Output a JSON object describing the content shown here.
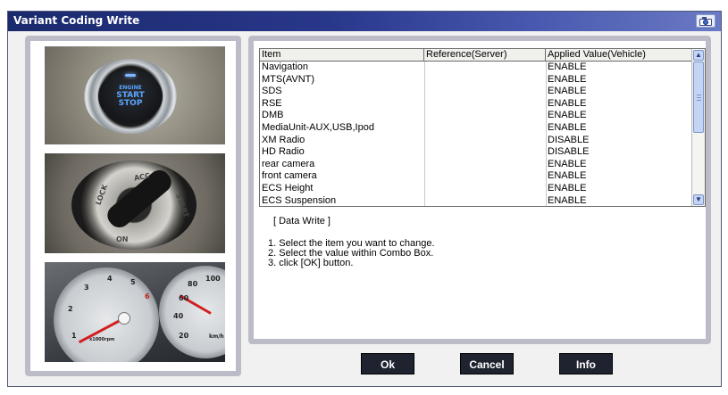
{
  "window": {
    "title": "Variant Coding Write",
    "camera_icon": "camera-icon"
  },
  "left_images": {
    "start_button": {
      "line1": "ENGINE",
      "line2": "START",
      "line3": "STOP"
    },
    "ignition_lock": {
      "lbl_lock": "LOCK",
      "lbl_acc": "ACC",
      "lbl_start": "START",
      "lbl_ign": "ON"
    },
    "gauges": {
      "tach": [
        "1",
        "2",
        "3",
        "4",
        "5",
        "6"
      ],
      "tach_unit": "x1000rpm",
      "speed": [
        "20",
        "40",
        "60",
        "80",
        "100"
      ],
      "speed_unit": "km/h"
    }
  },
  "table": {
    "columns": [
      "Item",
      "Reference(Server)",
      "Applied Value(Vehicle)"
    ],
    "rows": [
      {
        "item": "Navigation",
        "reference": "",
        "applied": "ENABLE"
      },
      {
        "item": "MTS(AVNT)",
        "reference": "",
        "applied": "ENABLE"
      },
      {
        "item": "SDS",
        "reference": "",
        "applied": "ENABLE"
      },
      {
        "item": "RSE",
        "reference": "",
        "applied": "ENABLE"
      },
      {
        "item": "DMB",
        "reference": "",
        "applied": "ENABLE"
      },
      {
        "item": "MediaUnit-AUX,USB,Ipod",
        "reference": "",
        "applied": "ENABLE"
      },
      {
        "item": "XM Radio",
        "reference": "",
        "applied": "DISABLE"
      },
      {
        "item": "HD Radio",
        "reference": "",
        "applied": "DISABLE"
      },
      {
        "item": "rear camera",
        "reference": "",
        "applied": "ENABLE"
      },
      {
        "item": "front camera",
        "reference": "",
        "applied": "ENABLE"
      },
      {
        "item": "ECS Height",
        "reference": "",
        "applied": "ENABLE"
      },
      {
        "item": "ECS Suspension",
        "reference": "",
        "applied": "ENABLE"
      }
    ]
  },
  "instructions": {
    "title": "[ Data Write ]",
    "steps": [
      "1. Select the item you want to change.",
      "2. Select the value within Combo Box.",
      "3. click [OK] button."
    ]
  },
  "buttons": {
    "ok": "Ok",
    "cancel": "Cancel",
    "info": "Info"
  }
}
